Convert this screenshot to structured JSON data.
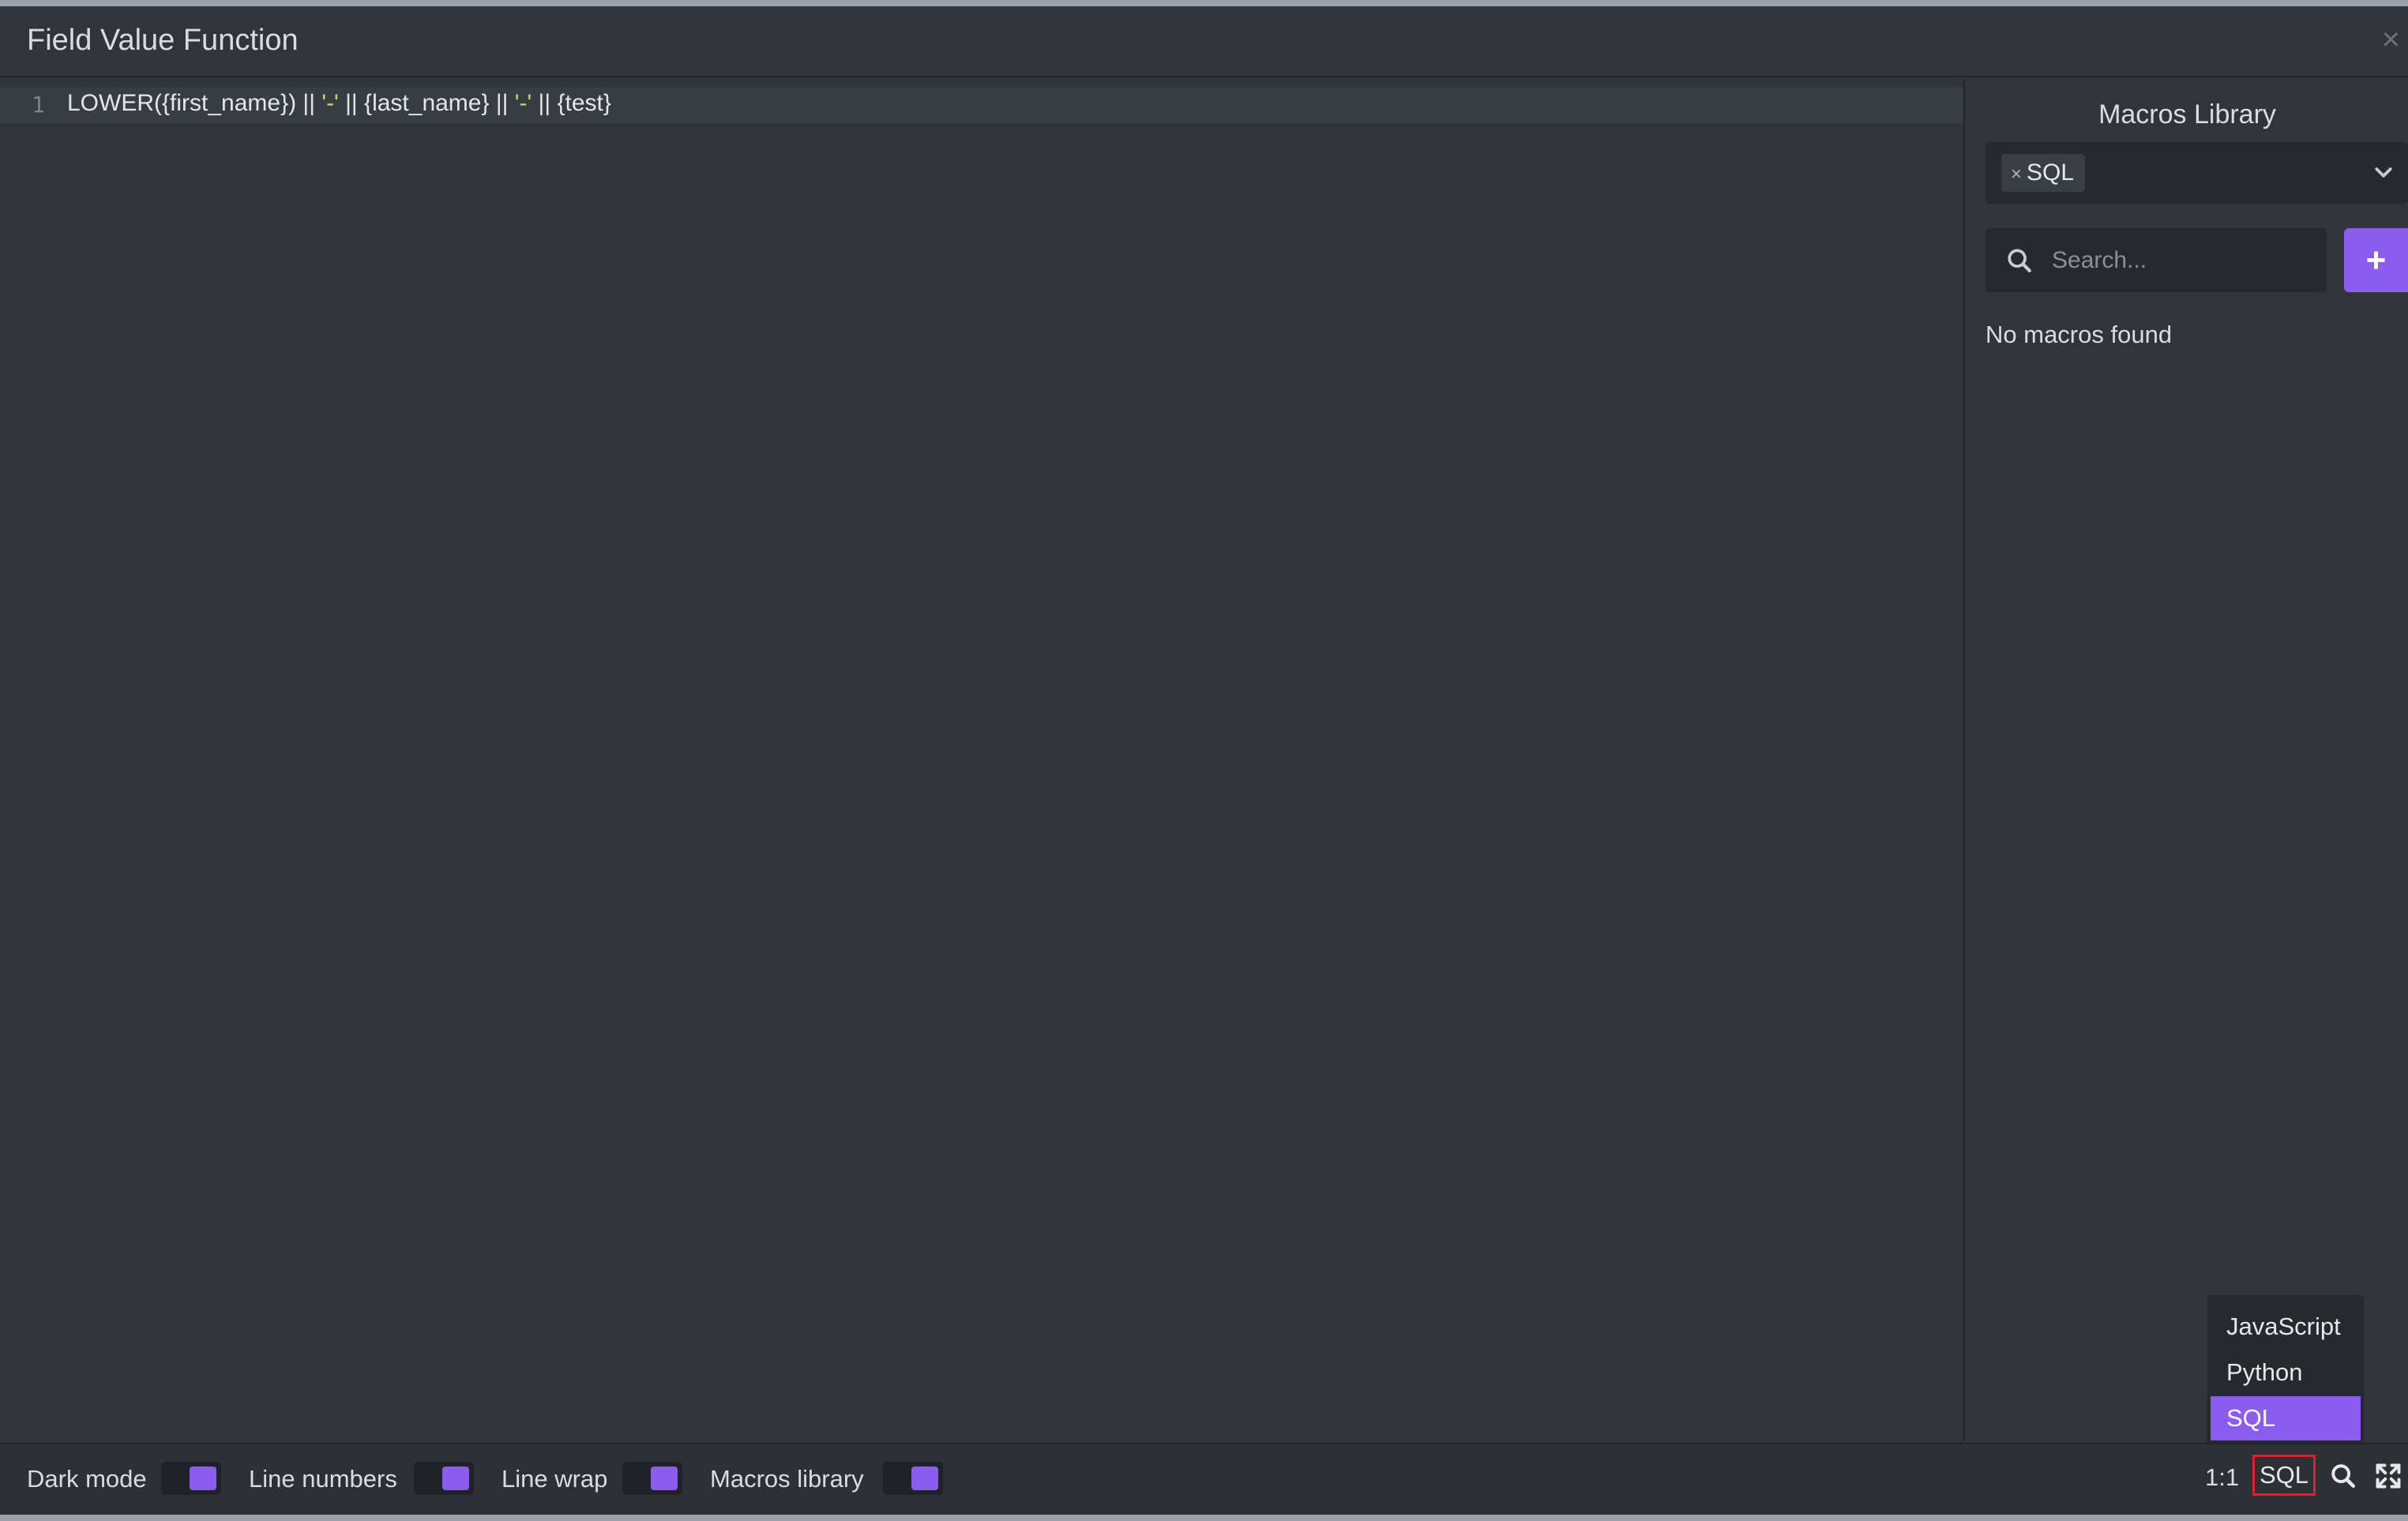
{
  "modal": {
    "title": "Field Value Function",
    "close_glyph": "×"
  },
  "editor": {
    "lines": [
      {
        "number": "1",
        "segments": [
          {
            "text": "LOWER({first_name}) || ",
            "type": "plain"
          },
          {
            "text": "'-'",
            "type": "string"
          },
          {
            "text": " || {last_name} || ",
            "type": "plain"
          },
          {
            "text": "'-'",
            "type": "string"
          },
          {
            "text": " || {test}",
            "type": "plain"
          }
        ]
      }
    ]
  },
  "macros": {
    "title": "Macros Library",
    "filter_tag": "SQL",
    "filter_tag_remove": "×",
    "search_placeholder": "Search...",
    "add_label": "+",
    "empty_text": "No macros found"
  },
  "language_menu": {
    "options": [
      "JavaScript",
      "Python",
      "SQL"
    ],
    "selected": "SQL"
  },
  "footer": {
    "toggles": [
      {
        "label": "Dark mode",
        "on": true
      },
      {
        "label": "Line numbers",
        "on": true
      },
      {
        "label": "Line wrap",
        "on": true
      },
      {
        "label": "Macros library",
        "on": true
      }
    ],
    "cursor_position": "1:1",
    "language": "SQL"
  },
  "icons": {
    "search": "search-icon",
    "expand": "expand-icon",
    "chevron": "chevron-down-icon",
    "close": "close-icon"
  },
  "colors": {
    "accent": "#8c5cf0",
    "highlight_border": "#e0202e",
    "string": "#c8d66a"
  }
}
